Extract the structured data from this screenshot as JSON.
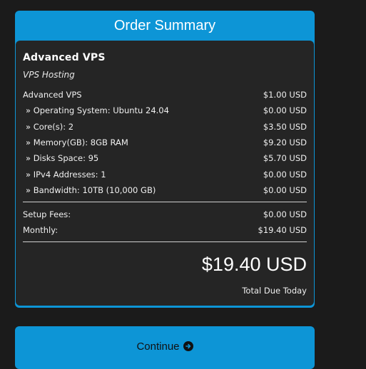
{
  "header": {
    "title": "Order Summary"
  },
  "product": {
    "name": "Advanced VPS",
    "group": "VPS Hosting"
  },
  "items": [
    {
      "label": "Advanced VPS",
      "price": "$1.00 USD"
    },
    {
      "label": "» Operating System: Ubuntu 24.04",
      "price": "$0.00 USD"
    },
    {
      "label": "» Core(s): 2",
      "price": "$3.50 USD"
    },
    {
      "label": "» Memory(GB): 8GB RAM",
      "price": "$9.20 USD"
    },
    {
      "label": "» Disks Space: 95",
      "price": "$5.70 USD"
    },
    {
      "label": "» IPv4 Addresses: 1",
      "price": "$0.00 USD"
    },
    {
      "label": "» Bandwidth: 10TB (10,000 GB)",
      "price": "$0.00 USD"
    }
  ],
  "fees": {
    "setup_label": "Setup Fees:",
    "setup_value": "$0.00 USD",
    "monthly_label": "Monthly:",
    "monthly_value": "$19.40 USD"
  },
  "total": {
    "amount": "$19.40 USD",
    "label": "Total Due Today"
  },
  "continue": {
    "label": "Continue",
    "icon": "arrow-circle-right-icon"
  },
  "colors": {
    "accent": "#0d95d6",
    "panel": "#252525",
    "background": "#1b1b1b"
  }
}
